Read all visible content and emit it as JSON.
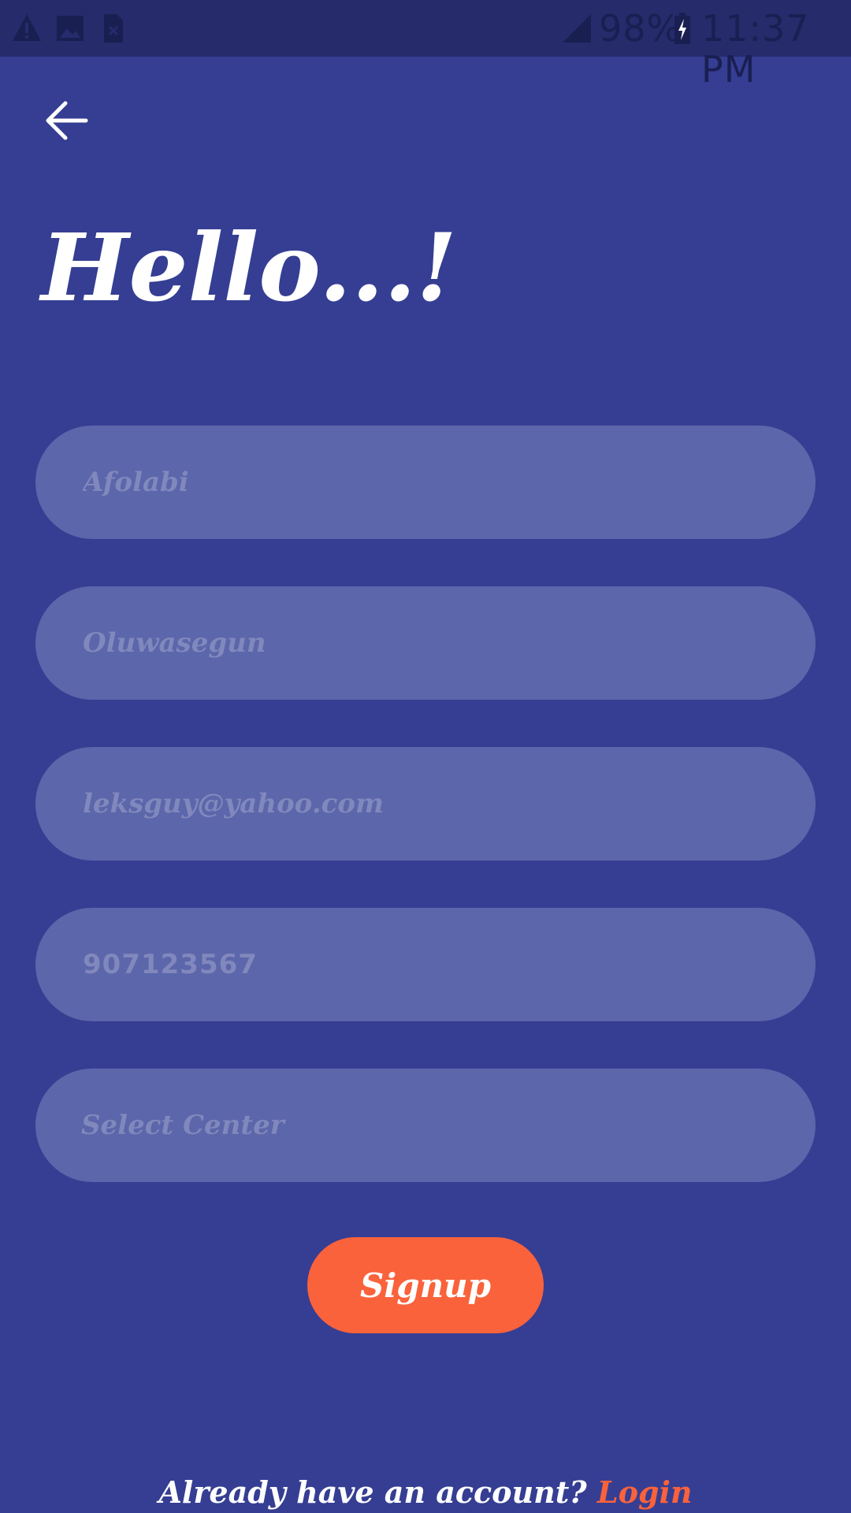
{
  "status_bar": {
    "icons_left": [
      "warning-icon",
      "image-icon",
      "sim-card-icon"
    ],
    "signal_icon": "signal-icon",
    "battery_percent": "98%",
    "battery_icon": "battery-charging-icon",
    "time": "11:37 PM"
  },
  "header": {
    "back_icon": "arrow-left-icon",
    "title": "Hello...!"
  },
  "form": {
    "first_name_placeholder": "Afolabi",
    "last_name_placeholder": "Oluwasegun",
    "email_placeholder": "leksguy@yahoo.com",
    "phone_placeholder": "907123567",
    "center_select_label": "Select Center"
  },
  "actions": {
    "signup_label": "Signup"
  },
  "footer": {
    "prompt": "Already have an account?",
    "login_label": "Login"
  },
  "colors": {
    "background": "#353e93",
    "status_bar": "#252b6b",
    "field_fill": "#5c66aa",
    "placeholder": "#8088bd",
    "accent": "#fa623b",
    "text": "#ffffff"
  }
}
